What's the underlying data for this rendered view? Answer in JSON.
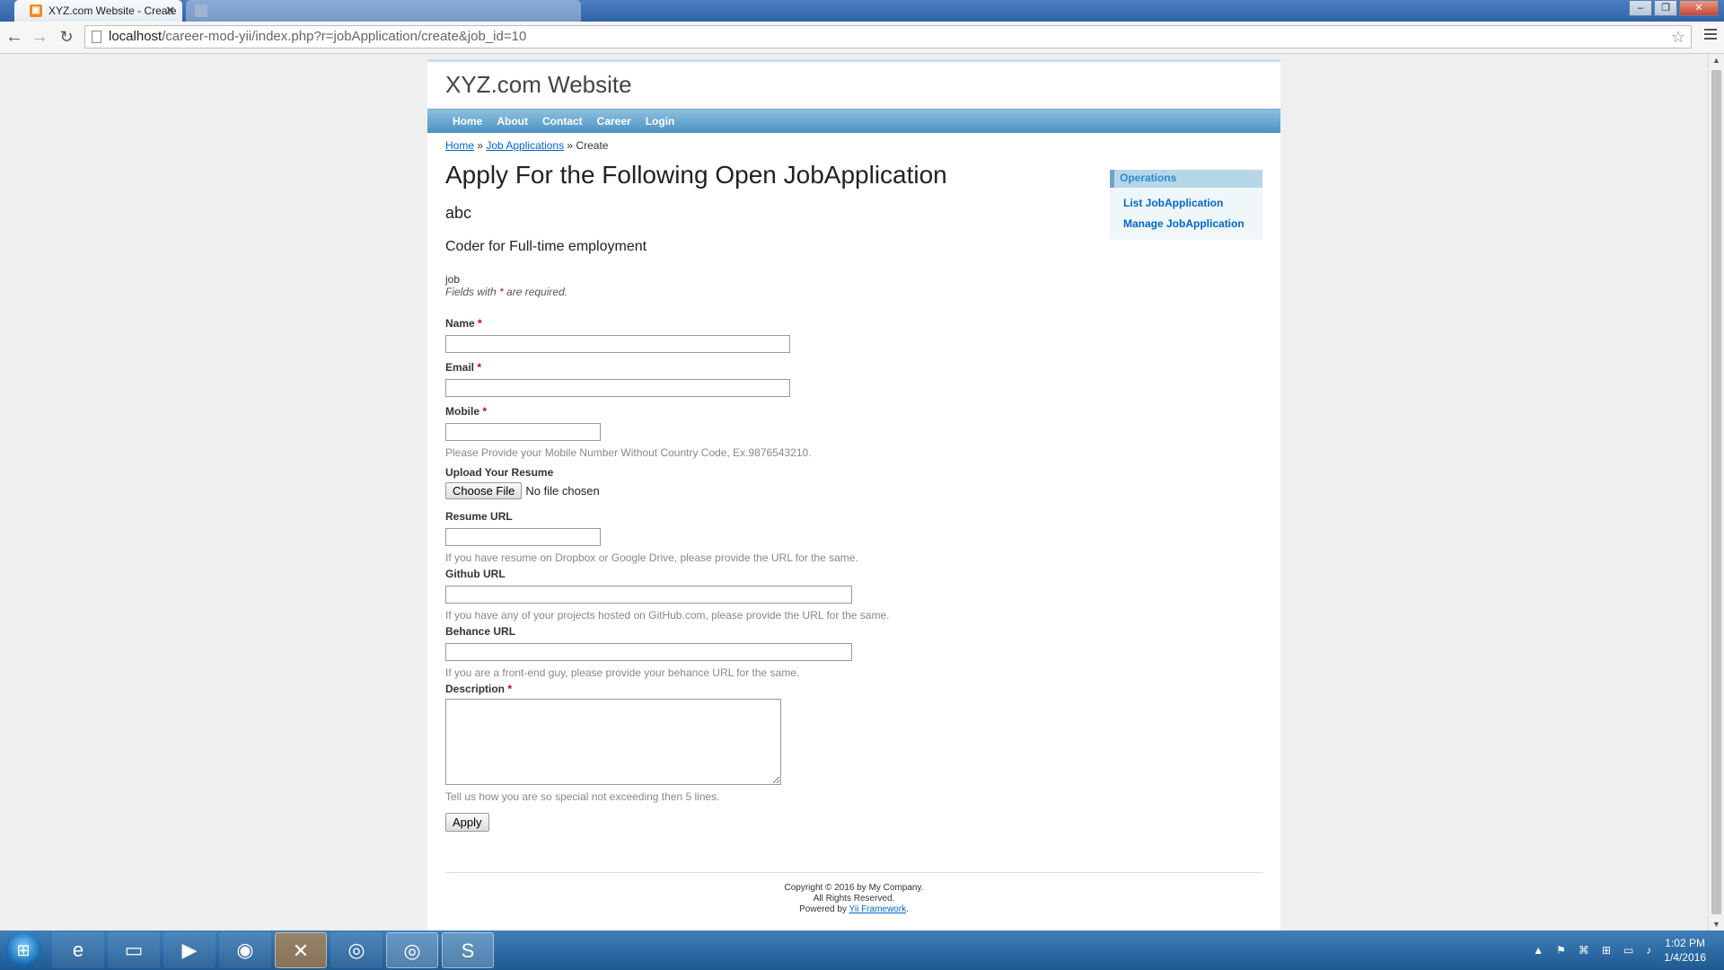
{
  "browser": {
    "tabs": [
      {
        "title": "XYZ.com Website - Create",
        "active": true
      },
      {
        "title": "",
        "active": false
      }
    ],
    "url_host": "localhost",
    "url_path": "/career-mod-yii/index.php?r=jobApplication/create&job_id=10"
  },
  "site": {
    "name": "XYZ.com Website",
    "menu": [
      "Home",
      "About",
      "Contact",
      "Career",
      "Login"
    ]
  },
  "breadcrumbs": {
    "home": "Home",
    "sep1": " » ",
    "job_apps": "Job Applications",
    "sep2": " » ",
    "current": "Create"
  },
  "content": {
    "title": "Apply For the Following Open JobApplication",
    "job_name": "abc",
    "job_desc": "Coder for Full-time employment",
    "form_name": "job",
    "required_note_pre": "Fields with ",
    "required_star": "*",
    "required_note_post": " are required."
  },
  "form": {
    "name_label": "Name",
    "email_label": "Email",
    "mobile_label": "Mobile",
    "mobile_hint": "Please Provide your Mobile Number Without Country Code, Ex.9876543210.",
    "resume_label": "Upload Your Resume",
    "choose_file": "Choose File",
    "no_file": "No file chosen",
    "resume_url_label": "Resume URL",
    "resume_url_hint": "If you have resume on Dropbox or Google Drive, please provide the URL for the same.",
    "github_label": "Github URL",
    "github_hint": "If you have any of your projects hosted on GitHub.com, please provide the URL for the same.",
    "behance_label": "Behance URL",
    "behance_hint": "If you are a front-end guy, please provide your behance URL for the same.",
    "description_label": "Description",
    "description_hint": "Tell us how you are so special not exceeding then 5 lines.",
    "submit": "Apply",
    "star": "*"
  },
  "sidebar": {
    "title": "Operations",
    "items": [
      "List JobApplication",
      "Manage JobApplication"
    ]
  },
  "footer": {
    "line1": "Copyright © 2016 by My Company.",
    "line2": "All Rights Reserved.",
    "line3_pre": "Powered by ",
    "line3_link": "Yii Framework",
    "line3_post": "."
  },
  "taskbar": {
    "time": "1:02 PM",
    "date": "1/4/2016"
  }
}
